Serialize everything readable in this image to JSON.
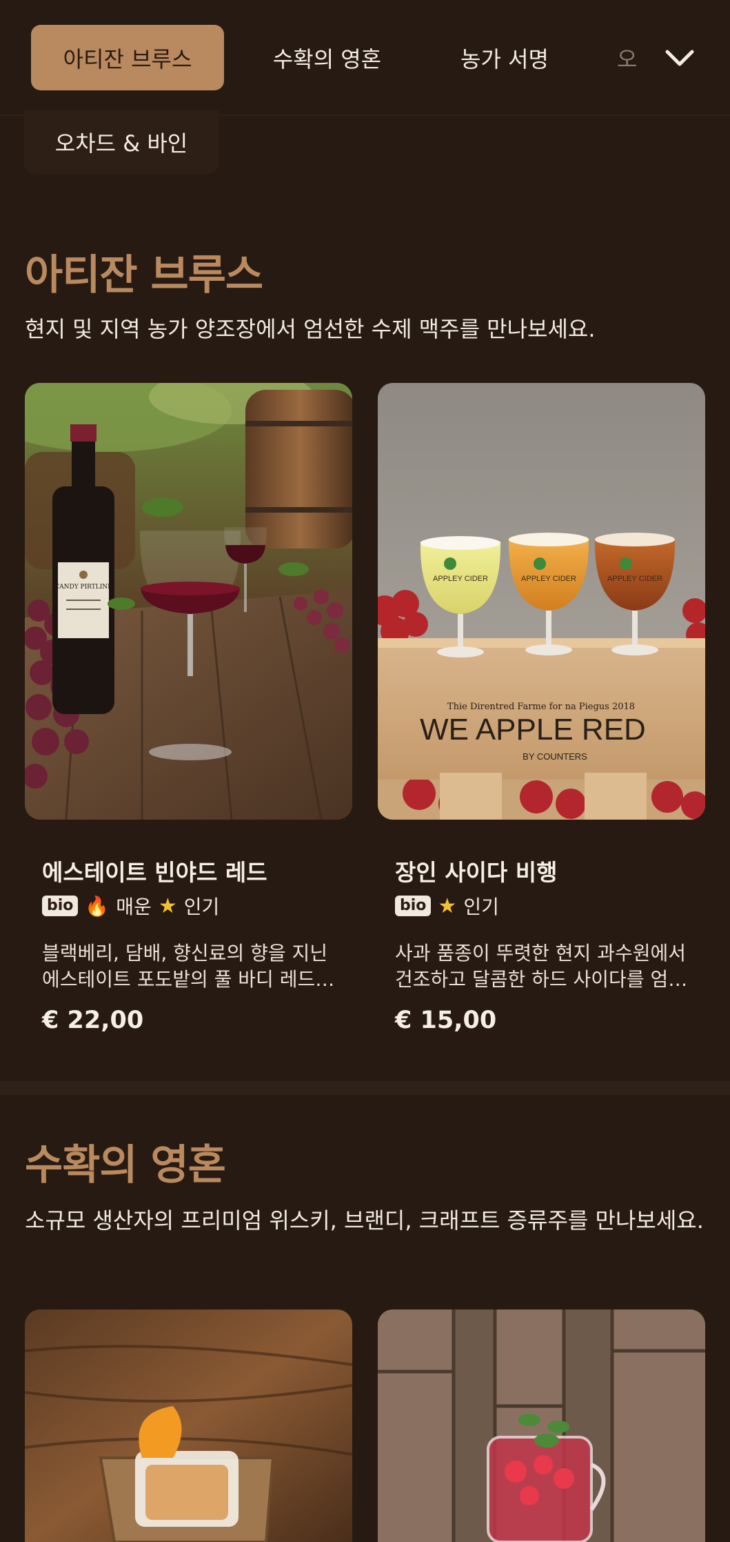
{
  "nav": {
    "tabs": [
      {
        "label": "아티잔 브루스",
        "active": true
      },
      {
        "label": "수확의 영혼",
        "active": false
      },
      {
        "label": "농가 서명",
        "active": false
      },
      {
        "label": "오",
        "active": false
      }
    ],
    "row2": "오차드 & 바인",
    "expand_icon": "chevron-down-icon"
  },
  "sections": [
    {
      "title": "아티잔 브루스",
      "description": "현지 및 지역 농가 양조장에서 엄선한 수제 맥주를 만나보세요.",
      "products": [
        {
          "name": "에스테이트 빈야드 레드",
          "badge": "bio",
          "tags": [
            "매운",
            "인기"
          ],
          "description_line1": "블랙베리, 담배, 향신료의 향을 지닌",
          "description_line2": "에스테이트 포도밭의 풀 바디 레드 와인",
          "price": "€ 22,00",
          "bottle_label": "CANDY PIRTLINE"
        },
        {
          "name": "장인 사이다 비행",
          "badge": "bio",
          "tags": [
            "인기"
          ],
          "description_line1": "사과 품종이 뚜렷한 현지 과수원에서",
          "description_line2": "건조하고 달콤한 하드 사이다를 엄선했습니다",
          "price": "€ 15,00",
          "crate_small": "Thie Direntred Farme for na Piegus 2018",
          "crate_big": "WE APPLE RED",
          "crate_sub": "BY COUNTERS",
          "glass_label": "APPLEY CIDER"
        }
      ]
    },
    {
      "title": "수확의 영혼",
      "description": "소규모 생산자의 프리미엄 위스키, 브랜디, 크래프트 증류주를 만나보세요."
    }
  ],
  "colors": {
    "background": "#271a12",
    "accent": "#b98a5f",
    "star": "#f2c230",
    "fire": "#e8512b"
  }
}
